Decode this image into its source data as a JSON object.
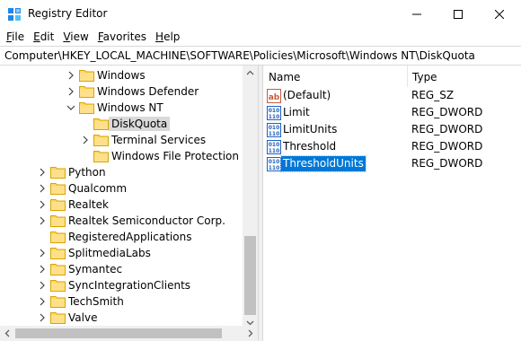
{
  "window": {
    "title": "Registry Editor"
  },
  "menu": [
    {
      "mnemonic": "F",
      "rest": "ile"
    },
    {
      "mnemonic": "E",
      "rest": "dit"
    },
    {
      "mnemonic": "V",
      "rest": "iew"
    },
    {
      "mnemonic": "F",
      "rest": "avorites"
    },
    {
      "mnemonic": "H",
      "rest": "elp"
    }
  ],
  "address": "Computer\\HKEY_LOCAL_MACHINE\\SOFTWARE\\Policies\\Microsoft\\Windows NT\\DiskQuota",
  "tree": [
    {
      "label": "Windows",
      "level": 2,
      "chevron": "right",
      "selected": false
    },
    {
      "label": "Windows Defender",
      "level": 2,
      "chevron": "right",
      "selected": false
    },
    {
      "label": "Windows NT",
      "level": 2,
      "chevron": "down",
      "selected": false
    },
    {
      "label": "DiskQuota",
      "level": 3,
      "chevron": "none",
      "selected": true
    },
    {
      "label": "Terminal Services",
      "level": 3,
      "chevron": "right",
      "selected": false
    },
    {
      "label": "Windows File Protection",
      "level": 3,
      "chevron": "none",
      "selected": false
    },
    {
      "label": "Python",
      "level": 0,
      "chevron": "right",
      "selected": false
    },
    {
      "label": "Qualcomm",
      "level": 0,
      "chevron": "right",
      "selected": false
    },
    {
      "label": "Realtek",
      "level": 0,
      "chevron": "right",
      "selected": false
    },
    {
      "label": "Realtek Semiconductor Corp.",
      "level": 0,
      "chevron": "right",
      "selected": false
    },
    {
      "label": "RegisteredApplications",
      "level": 0,
      "chevron": "none",
      "selected": false
    },
    {
      "label": "SplitmediaLabs",
      "level": 0,
      "chevron": "right",
      "selected": false
    },
    {
      "label": "Symantec",
      "level": 0,
      "chevron": "right",
      "selected": false
    },
    {
      "label": "SyncIntegrationClients",
      "level": 0,
      "chevron": "right",
      "selected": false
    },
    {
      "label": "TechSmith",
      "level": 0,
      "chevron": "right",
      "selected": false
    },
    {
      "label": "Valve",
      "level": 0,
      "chevron": "right",
      "selected": false
    }
  ],
  "list": {
    "columns": {
      "name": "Name",
      "type": "Type"
    },
    "rows": [
      {
        "name": "(Default)",
        "type": "REG_SZ",
        "icon": "string-value-icon",
        "selected": false
      },
      {
        "name": "Limit",
        "type": "REG_DWORD",
        "icon": "binary-value-icon",
        "selected": false
      },
      {
        "name": "LimitUnits",
        "type": "REG_DWORD",
        "icon": "binary-value-icon",
        "selected": false
      },
      {
        "name": "Threshold",
        "type": "REG_DWORD",
        "icon": "binary-value-icon",
        "selected": false
      },
      {
        "name": "ThresholdUnits",
        "type": "REG_DWORD",
        "icon": "binary-value-icon",
        "selected": true
      }
    ]
  },
  "colors": {
    "selection": "#0078d7",
    "tree_selection": "#d9d9d9",
    "folder": "#ffd766"
  }
}
